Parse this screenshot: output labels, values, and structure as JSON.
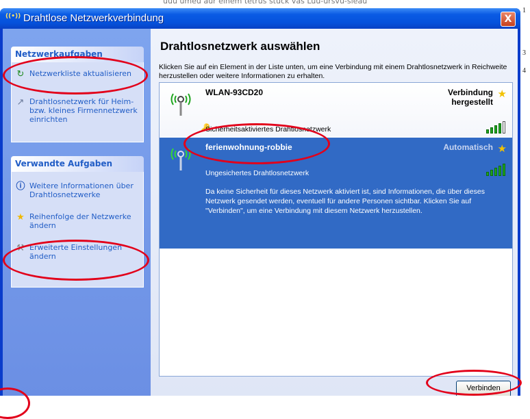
{
  "background": {
    "top_text": "uuu umeu aur einem tetrus stuck vas Luu-ursvu-sieau",
    "right_margin_chars": [
      "1",
      "3",
      "4"
    ]
  },
  "window": {
    "title": "Drahtlose Netzwerkverbindung",
    "title_icon": "((•))",
    "close_glyph": "X"
  },
  "sidebar": {
    "network_tasks": {
      "heading": "Netzwerkaufgaben",
      "items": [
        {
          "label": "Netzwerkliste aktualisieren",
          "icon": "refresh-icon"
        },
        {
          "label": "Drahtlosnetzwerk für Heim- bzw. kleines Firmennetzwerk einrichten",
          "icon": "wireless-setup-icon"
        }
      ]
    },
    "related_tasks": {
      "heading": "Verwandte Aufgaben",
      "items": [
        {
          "label": "Weitere Informationen über Drahtlosnetzwerke",
          "icon": "info-icon"
        },
        {
          "label": "Reihenfolge der Netzwerke ändern",
          "icon": "star-icon"
        },
        {
          "label": "Erweiterte Einstellungen ändern",
          "icon": "settings-icon"
        }
      ]
    }
  },
  "main": {
    "title": "Drahtlosnetzwerk auswählen",
    "description": "Klicken Sie auf ein Element in der Liste unten, um eine Verbindung mit einem Drahtlosnetzwerk in Reichweite herzustellen oder weitere Informationen zu erhalten.",
    "networks": [
      {
        "ssid": "WLAN-93CD20",
        "status": "Verbindung hergestellt",
        "security": "Sicherheitsaktiviertes Drahtlosnetzwerk",
        "signal_bars": 4,
        "selected": false
      },
      {
        "ssid": "ferienwohnung-robbie",
        "status": "Automatisch",
        "security": "Ungesichertes Drahtlosnetzwerk",
        "signal_bars": 5,
        "selected": true,
        "details": "Da keine Sicherheit für dieses Netzwerk aktiviert ist, sind Informationen, die über dieses Netzwerk gesendet werden, eventuell für andere Personen sichtbar. Klicken Sie auf \"Verbinden\", um eine Verbindung mit diesem Netzwerk herzustellen."
      }
    ],
    "connect_button": "Verbinden"
  },
  "colors": {
    "titlebar": "#0552dc",
    "selected_row": "#316ac5",
    "annotation": "#e2001a",
    "link": "#215dc6"
  }
}
